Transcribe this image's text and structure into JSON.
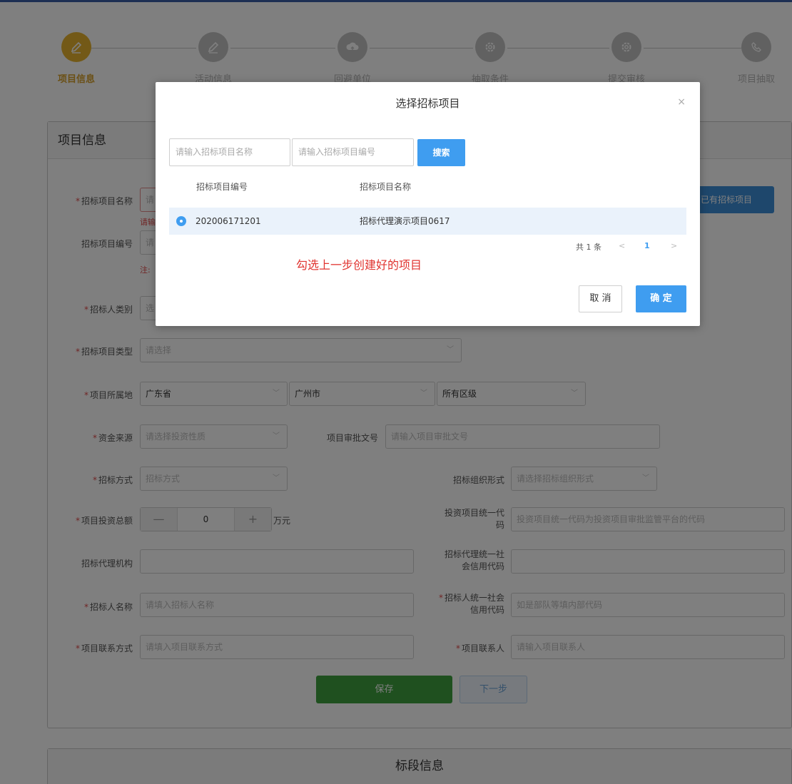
{
  "steps": [
    {
      "label": "项目信息",
      "icon": "pencil-icon"
    },
    {
      "label": "活动信息",
      "icon": "pencil-icon"
    },
    {
      "label": "回避单位",
      "icon": "cloud-upload-icon"
    },
    {
      "label": "抽取条件",
      "icon": "gear-icon"
    },
    {
      "label": "提交审核",
      "icon": "gear-icon"
    },
    {
      "label": "项目抽取",
      "icon": "phone-icon"
    }
  ],
  "panel": {
    "title": "项目信息"
  },
  "form": {
    "tender_name": {
      "label": "招标项目名称",
      "placeholder": "请",
      "error": "请输"
    },
    "tender_no": {
      "label": "招标项目编号",
      "placeholder": "请",
      "note": "注:"
    },
    "tenderer_type": {
      "label": "招标人类别",
      "placeholder": "选"
    },
    "project_type": {
      "label": "招标项目类型",
      "placeholder": "请选择"
    },
    "location": {
      "label": "项目所属地",
      "province": "广东省",
      "city": "广州市",
      "district": "所有区级"
    },
    "fund_source": {
      "label": "资金来源",
      "placeholder": "请选择投资性质"
    },
    "approval_no": {
      "label": "项目审批文号",
      "placeholder": "请输入项目审批文号"
    },
    "bid_method": {
      "label": "招标方式",
      "placeholder": "招标方式"
    },
    "org_form": {
      "label": "招标组织形式",
      "placeholder": "请选择招标组织形式"
    },
    "total_investment": {
      "label": "项目投资总额",
      "value": "0",
      "unit": "万元",
      "minus": "—",
      "plus": "+"
    },
    "invest_code": {
      "label_1": "投资项目统一代",
      "label_2": "码",
      "placeholder": "投资项目统一代码为投资项目审批监管平台的代码"
    },
    "agency": {
      "label": "招标代理机构"
    },
    "agency_credit": {
      "label_1": "招标代理统一社",
      "label_2": "会信用代码"
    },
    "tenderer_name": {
      "label": "招标人名称",
      "placeholder": "请填入招标人名称"
    },
    "tenderer_credit": {
      "label_1": "招标人统一社会",
      "label_2": "信用代码",
      "placeholder": "如是部队等填内部代码"
    },
    "contact_method": {
      "label": "项目联系方式",
      "placeholder": "请填入项目联系方式"
    },
    "contact_person": {
      "label": "项目联系人",
      "placeholder": "请输入项目联系人"
    },
    "select_existing": "已有招标项目",
    "save": "保存",
    "next": "下一步"
  },
  "bottom_panel": {
    "title": "标段信息"
  },
  "modal": {
    "title": "选择招标项目",
    "close": "×",
    "name_placeholder": "请输入招标项目名称",
    "no_placeholder": "请输入招标项目编号",
    "search": "搜索",
    "columns": [
      "招标项目编号",
      "招标项目名称"
    ],
    "rows": [
      {
        "no": "202006171201",
        "name": "招标代理演示项目0617"
      }
    ],
    "pager": {
      "total": "共 1 条",
      "prev": "<",
      "page": "1",
      "next": ">"
    },
    "hint": "勾选上一步创建好的项目",
    "cancel": "取 消",
    "ok": "确 定"
  }
}
